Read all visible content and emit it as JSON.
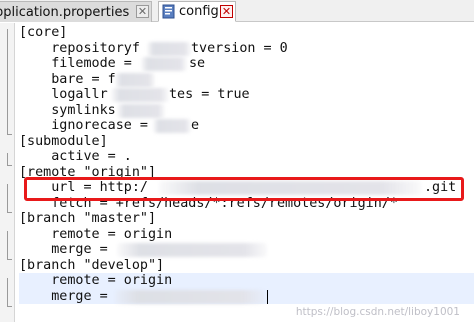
{
  "tabs": [
    {
      "label": "pplication.properties",
      "active": false,
      "close_icon": "close-icon"
    },
    {
      "label": "config",
      "active": true,
      "close_icon": "close-icon"
    }
  ],
  "editor": {
    "lines": [
      "[core]",
      "\trepositoryf",
      "\tfilemode = ",
      "\tbare = f",
      "\tlogallr",
      "\tsymlinks",
      "\tignorecase = ",
      "[submodule]",
      "\tactive = .",
      "[remote \"origin\"]",
      "\turl = http:/",
      "\tfetch = +refs/heads/*:refs/remotes/origin/*",
      "[branch \"master\"]",
      "\tremote = origin",
      "\tmerge = ",
      "[branch \"develop\"]",
      "\tremote = origin",
      "\tmerge = "
    ],
    "line_tails": {
      "1": "tversion = 0",
      "2": "se",
      "4": "tes = true",
      "6": "e",
      "10": ".git"
    }
  },
  "watermark": "https://blog.csdn.net/liboy1001",
  "colors": {
    "highlight_border": "#e8191a",
    "current_line": "#e8f0ff",
    "tab_close_active": "#c00000"
  }
}
